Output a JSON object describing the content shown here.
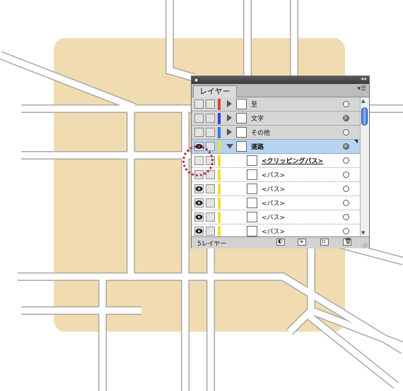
{
  "panel": {
    "tab_label": "レイヤー",
    "footer_count": "5レイヤー",
    "colors": {
      "background_block": "#f0dcb0",
      "road_fill": "#ffffff",
      "road_edge": "#a8a8a8",
      "highlight_ring": "#b0305a",
      "selected_row": "#b7d3f2"
    }
  },
  "layers": [
    {
      "name": "至",
      "color": "#e83a3a",
      "expanded": false
    },
    {
      "name": "文字",
      "color": "#3346d8",
      "expanded": false
    },
    {
      "name": "その他",
      "color": "#2a7ee0",
      "expanded": false
    },
    {
      "name": "道路",
      "color": "#f0e030",
      "expanded": true,
      "selected": true
    }
  ],
  "sublayers": [
    {
      "name": "<クリッピングパス>",
      "clipping": true,
      "visible": false
    },
    {
      "name": "<パス>",
      "visible": false
    },
    {
      "name": "<パス>",
      "visible": true
    },
    {
      "name": "<パス>",
      "visible": true
    },
    {
      "name": "<パス>",
      "visible": true
    },
    {
      "name": "<パス>",
      "visible": true
    }
  ],
  "footer_buttons": [
    "make-clipping-mask-icon",
    "new-sublayer-icon",
    "new-layer-icon",
    "trash-icon"
  ]
}
